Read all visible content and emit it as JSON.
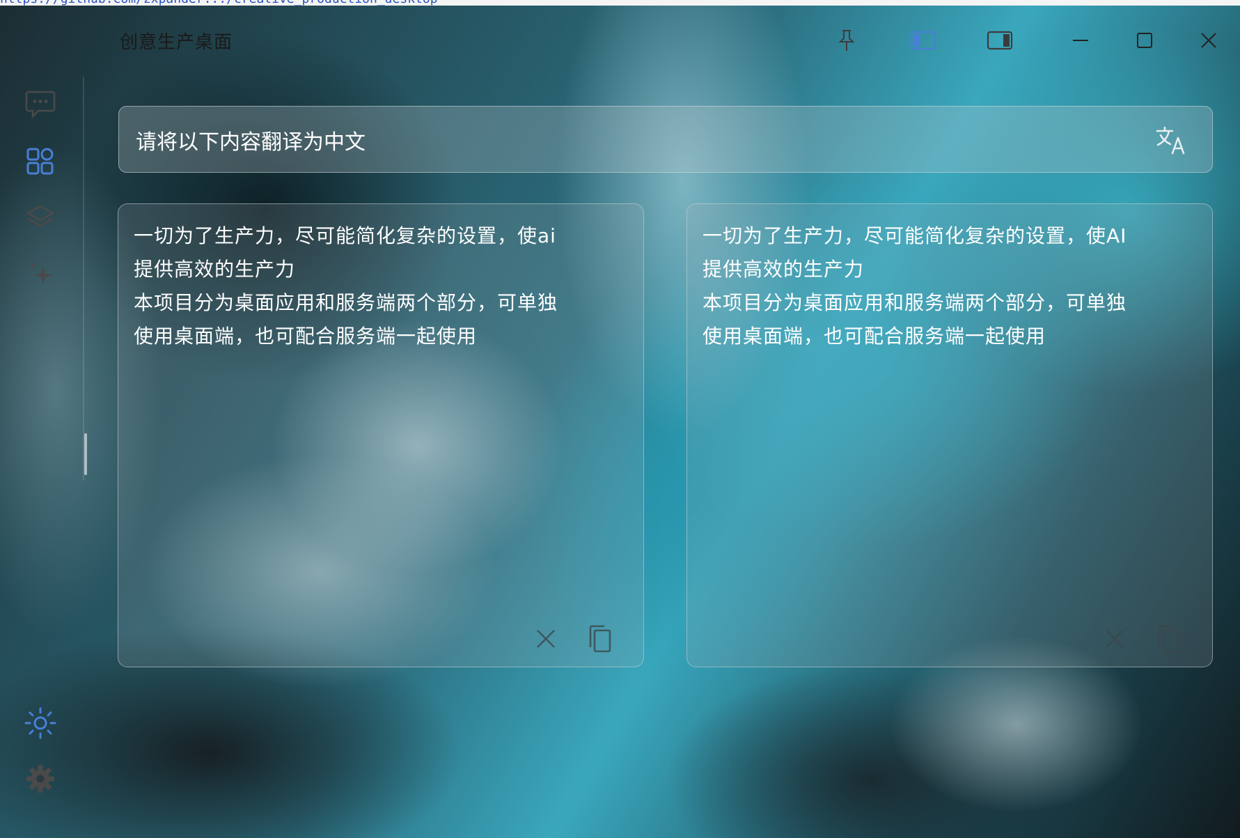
{
  "browser": {
    "url_fragment": "https://github.com/zxpander.../creative_production_desktop"
  },
  "app": {
    "title": "创意生产桌面"
  },
  "titlebar": {
    "buttons": [
      {
        "name": "pin",
        "icon": "pin-icon"
      },
      {
        "name": "left-sidebar-layout",
        "icon": "sidebar-left-icon",
        "active": true
      },
      {
        "name": "right-sidebar-layout",
        "icon": "sidebar-right-icon"
      },
      {
        "name": "minimize",
        "icon": "minimize-icon"
      },
      {
        "name": "maximize",
        "icon": "maximize-icon"
      },
      {
        "name": "close",
        "icon": "close-icon"
      }
    ]
  },
  "sidebar": {
    "top_items": [
      {
        "name": "chat",
        "icon": "chat-bubble-icon"
      },
      {
        "name": "apps",
        "icon": "apps-grid-icon",
        "active": true
      },
      {
        "name": "layers",
        "icon": "layers-icon"
      },
      {
        "name": "sparkle",
        "icon": "sparkle-icon"
      }
    ],
    "bottom_items": [
      {
        "name": "theme",
        "icon": "sun-icon",
        "active": true
      },
      {
        "name": "settings",
        "icon": "gear-icon"
      }
    ]
  },
  "prompt": {
    "value": "请将以下内容翻译为中文",
    "action_icon": "translate-icon"
  },
  "source_panel": {
    "text": "一切为了生产力，尽可能简化复杂的设置，使ai\n提供高效的生产力\n本项目分为桌面应用和服务端两个部分，可单独\n使用桌面端，也可配合服务端一起使用",
    "buttons": [
      {
        "name": "clear",
        "icon": "clear-x-icon"
      },
      {
        "name": "copy",
        "icon": "copy-icon"
      }
    ]
  },
  "result_panel": {
    "text": "一切为了生产力，尽可能简化复杂的设置，使AI\n提供高效的生产力\n本项目分为桌面应用和服务端两个部分，可单独\n使用桌面端，也可配合服务端一起使用",
    "buttons": [
      {
        "name": "clear",
        "icon": "clear-x-icon"
      },
      {
        "name": "copy",
        "icon": "copy-icon"
      }
    ]
  },
  "colors": {
    "accent": "#4a7fd8",
    "icon_muted": "#4a4a4a",
    "text": "#ffffff"
  }
}
